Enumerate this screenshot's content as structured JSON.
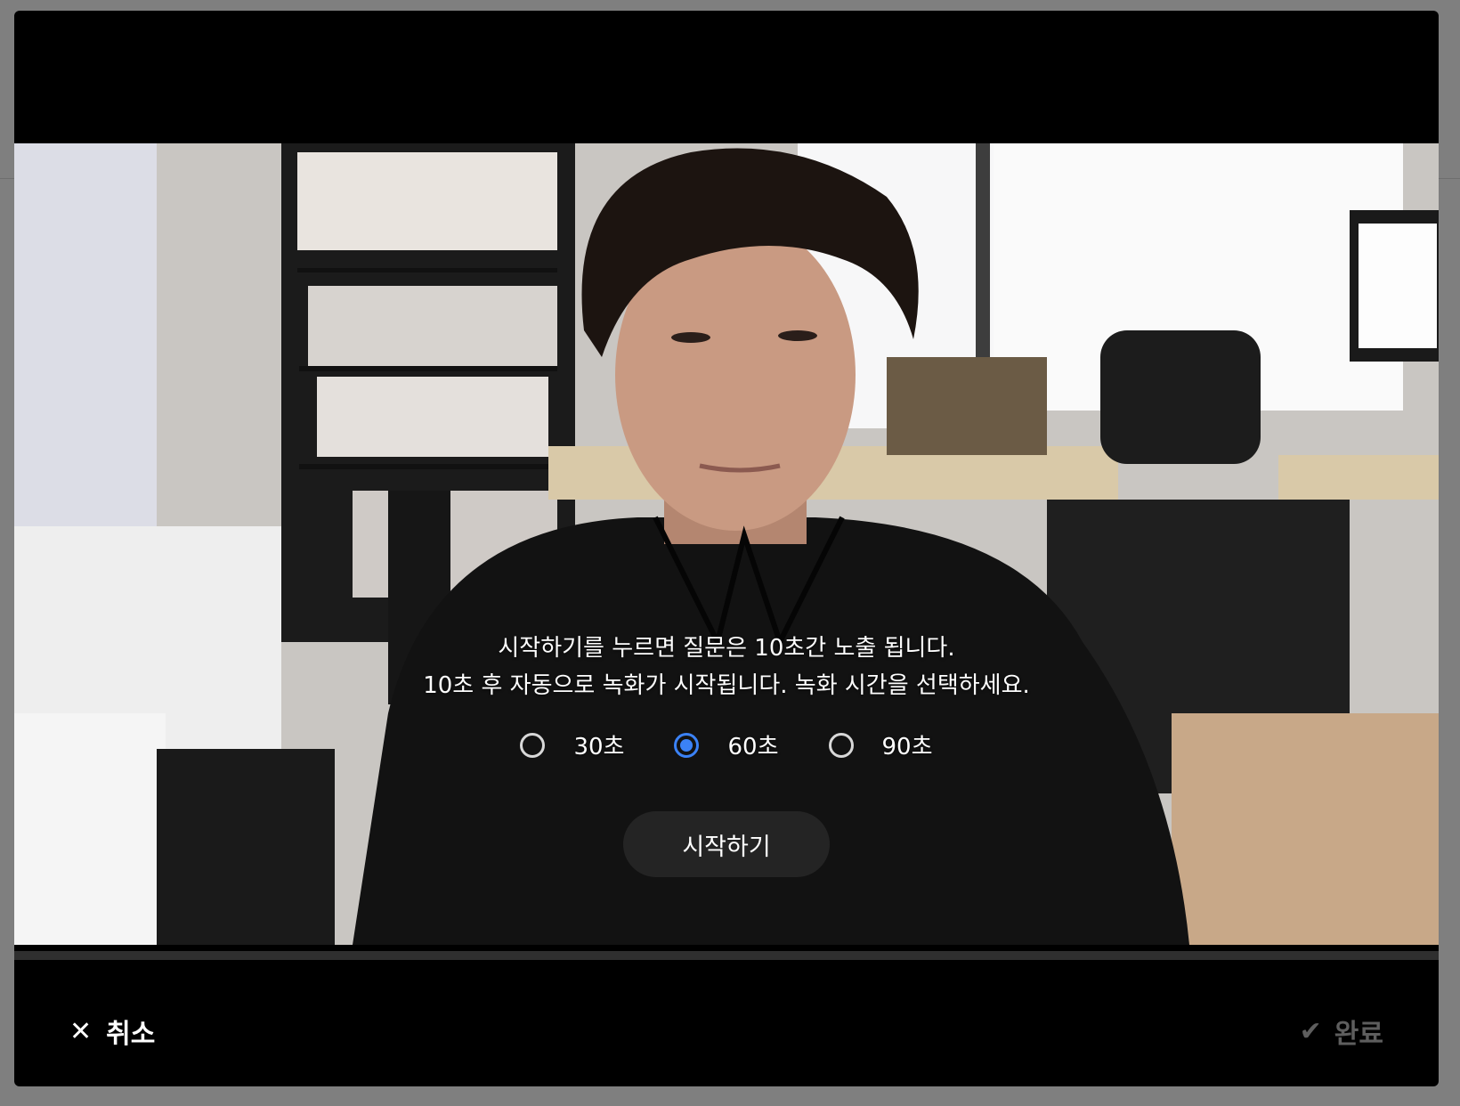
{
  "video": {
    "instruction_line1": "시작하기를 누르면 질문은 10초간 노출 됩니다.",
    "instruction_line2": "10초 후 자동으로 녹화가 시작됩니다. 녹화 시간을 선택하세요.",
    "duration_options": [
      {
        "label": "30초",
        "selected": false
      },
      {
        "label": "60초",
        "selected": true
      },
      {
        "label": "90초",
        "selected": false
      }
    ],
    "start_label": "시작하기"
  },
  "footer": {
    "cancel_label": "취소",
    "done_label": "완료"
  },
  "colors": {
    "accent": "#3b82f6",
    "modal_bg": "#000000",
    "disabled_text": "#5e5e5e"
  },
  "icons": {
    "cancel": "close-icon",
    "done": "check-icon"
  }
}
